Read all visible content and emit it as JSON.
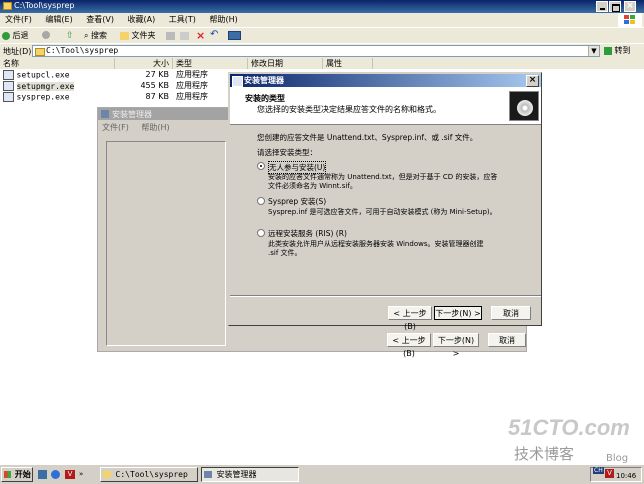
{
  "explorer": {
    "title": "C:\\Tool\\sysprep",
    "menu": [
      "文件(F)",
      "编辑(E)",
      "查看(V)",
      "收藏(A)",
      "工具(T)",
      "帮助(H)"
    ],
    "toolbar": {
      "back": "后退",
      "search": "搜索",
      "folders": "文件夹"
    },
    "address_label": "地址(D)",
    "address_value": "C:\\Tool\\sysprep",
    "go": "转到",
    "columns": [
      "名称",
      "大小",
      "类型",
      "修改日期",
      "属性"
    ],
    "files": [
      {
        "name": "setupcl.exe",
        "size": "27 KB",
        "type": "应用程序"
      },
      {
        "name": "setupmgr.exe",
        "size": "455 KB",
        "type": "应用程序"
      },
      {
        "name": "sysprep.exe",
        "size": "87 KB",
        "type": "应用程序"
      }
    ]
  },
  "bg_window": {
    "title": "安装管理器",
    "menu": [
      "文件(F)",
      "帮助(H)"
    ],
    "buttons": {
      "back": "< 上一步(B)",
      "next": "下一步(N) >",
      "cancel": "取消"
    }
  },
  "wizard": {
    "title": "安装管理器",
    "header_title": "安装的类型",
    "header_sub": "您选择的安装类型决定结果应答文件的名称和格式。",
    "intro": "您创建的应答文件是 Unattend.txt、Sysprep.inf、或 .sif 文件。",
    "choose": "请选择安装类型：",
    "options": [
      {
        "label": "无人参与安装(U)",
        "desc1": "安装的应答文件通常称为 Unattend.txt，但是对于基于 CD 的安装，应答",
        "desc2": "文件必须命名为 Winnt.sif。",
        "selected": true
      },
      {
        "label": "Sysprep 安装(S)",
        "desc1": "Sysprep.inf 是可选应答文件，可用于自动安装模式 (称为 Mini-Setup)。",
        "desc2": "",
        "selected": false
      },
      {
        "label": "远程安装服务 (RIS) (R)",
        "desc1": "此类安装允许用户从远程安装服务器安装 Windows。安装管理器创建",
        "desc2": ".sif 文件。",
        "selected": false
      }
    ],
    "buttons": {
      "back": "< 上一步(B)",
      "next": "下一步(N) >",
      "cancel": "取消"
    }
  },
  "taskbar": {
    "start": "开始",
    "tasks": [
      "C:\\Tool\\sysprep",
      "安装管理器"
    ],
    "clock": "10:46",
    "tray_lang": "CH"
  },
  "watermark": {
    "site": "51CTO.com",
    "blog": "技术博客",
    "blog_en": "Blog"
  }
}
